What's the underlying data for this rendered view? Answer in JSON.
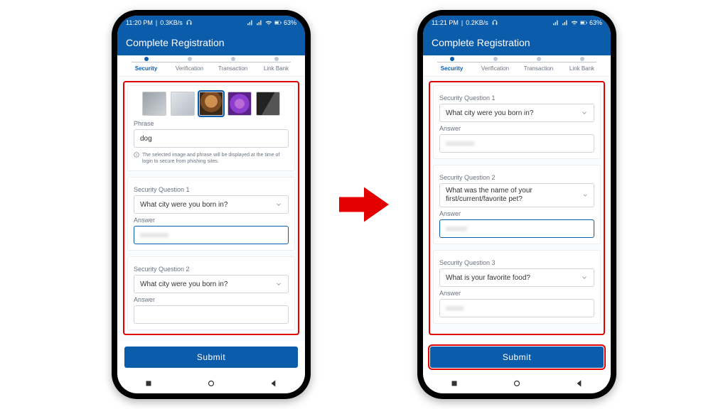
{
  "status": {
    "left": {
      "time": "11:20 PM",
      "rate": "0.3KB/s"
    },
    "left2": {
      "time": "11:21 PM",
      "rate": "0.2KB/s"
    },
    "battery": "63%"
  },
  "app_title": "Complete Registration",
  "steps": [
    "Security",
    "Verification",
    "Transaction",
    "Link Bank"
  ],
  "phrase": {
    "label": "Phrase",
    "value": "dog",
    "info": "The selected image and phrase will be displayed at the time of login to secure from phishing sites."
  },
  "left": {
    "q1": {
      "label": "Security Question 1",
      "value": "What city were you born in?",
      "answer_label": "Answer",
      "answer": "xxxxxxxx"
    },
    "q2": {
      "label": "Security Question 2",
      "value": "What city were you born in?",
      "answer_label": "Answer",
      "answer": ""
    }
  },
  "right": {
    "q1": {
      "label": "Security Question 1",
      "value": "What city were you born in?",
      "answer_label": "Answer",
      "answer": "xxxxxxxx"
    },
    "q2": {
      "label": "Security Question 2",
      "value": "What was the name of your first/current/favorite pet?",
      "answer_label": "Answer",
      "answer": "xxxxxx"
    },
    "q3": {
      "label": "Security Question 3",
      "value": "What is your favorite food?",
      "answer_label": "Answer",
      "answer": "xxxxx"
    }
  },
  "submit": "Submit"
}
